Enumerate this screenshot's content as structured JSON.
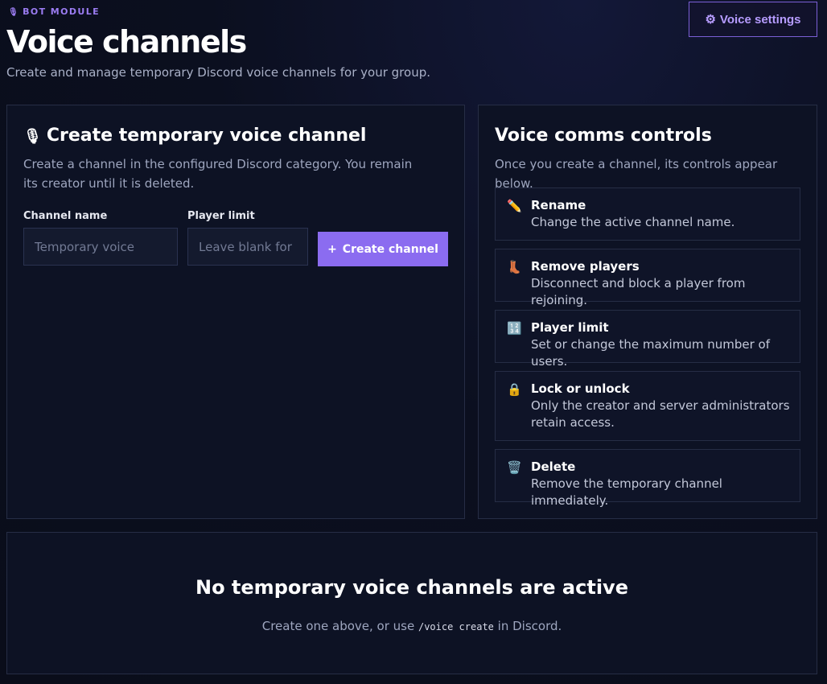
{
  "header": {
    "eyebrow": "BOT MODULE",
    "eyebrow_icon": "microphone-icon",
    "title": "Voice channels",
    "subtitle": "Create and manage temporary Discord voice channels for your group.",
    "settings_button": {
      "icon": "⚙",
      "label": "Voice settings"
    }
  },
  "create_panel": {
    "title": "Create temporary voice channel",
    "title_icon": "🎙",
    "description": "Create a channel in the configured Discord category. You remain its creator until it is deleted.",
    "channel_name": {
      "label": "Channel name",
      "placeholder": "Temporary voice",
      "value": ""
    },
    "player_limit": {
      "label": "Player limit",
      "placeholder": "Leave blank for",
      "value": ""
    },
    "create_button": {
      "icon": "+",
      "label": "Create channel"
    }
  },
  "controls_panel": {
    "title": "Voice comms controls",
    "description": "Once you create a channel, its controls appear below.",
    "items": [
      {
        "icon": "pencil-icon",
        "glyph": "✏️",
        "title": "Rename",
        "text": "Change the active channel name."
      },
      {
        "icon": "boot-icon",
        "glyph": "👢",
        "title": "Remove players",
        "text": "Disconnect and block a player from rejoining."
      },
      {
        "icon": "numbers-icon",
        "glyph": "🔢",
        "title": "Player limit",
        "text": "Set or change the maximum number of users."
      },
      {
        "icon": "lock-icon",
        "glyph": "🔒",
        "title": "Lock or unlock",
        "text": "Only the creator and server administrators retain access."
      },
      {
        "icon": "wastebasket-icon",
        "glyph": "🗑️",
        "title": "Delete",
        "text": "Remove the temporary channel immediately."
      }
    ]
  },
  "empty_state": {
    "title": "No temporary voice channels are active",
    "text_before": "Create one above, or use ",
    "command": "/voice create",
    "text_after": " in Discord."
  },
  "colors": {
    "accent": "#8b6cf0",
    "accent_border": "#7b5fd6",
    "panel_bg": "#0d1224",
    "page_bg": "#0b0f1d"
  }
}
